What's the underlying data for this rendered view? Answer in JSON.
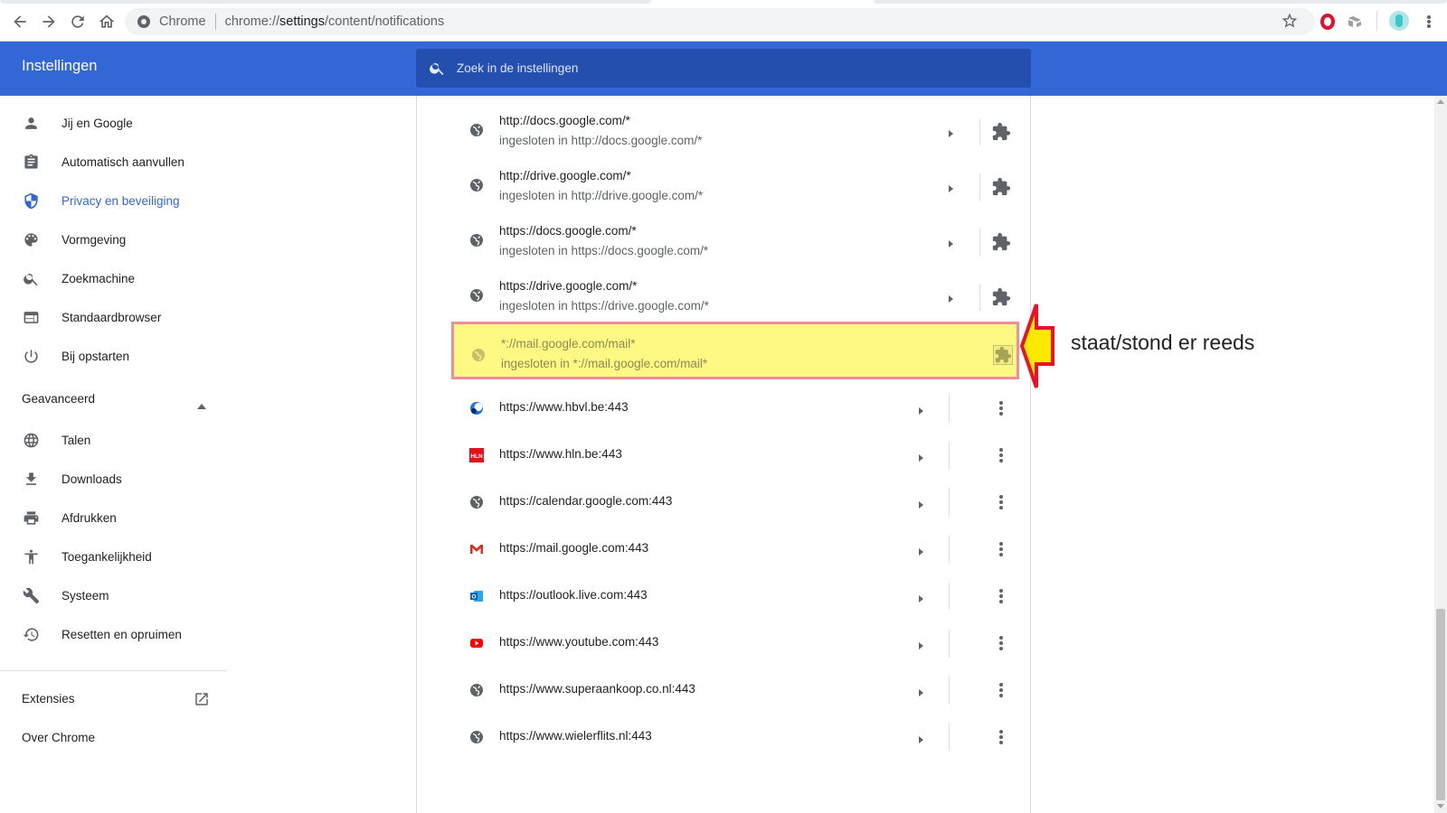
{
  "browser": {
    "chip_label": "Chrome",
    "url_scheme": "chrome://",
    "url_host": "settings",
    "url_path": "/content/notifications"
  },
  "header": {
    "title": "Instellingen",
    "search_placeholder": "Zoek in de instellingen"
  },
  "sidebar": {
    "items": [
      {
        "label": "Jij en Google",
        "icon": "person-icon"
      },
      {
        "label": "Automatisch aanvullen",
        "icon": "clipboard-icon"
      },
      {
        "label": "Privacy en beveiliging",
        "icon": "shield-icon",
        "active": true
      },
      {
        "label": "Vormgeving",
        "icon": "palette-icon"
      },
      {
        "label": "Zoekmachine",
        "icon": "search-icon"
      },
      {
        "label": "Standaardbrowser",
        "icon": "browser-window-icon"
      },
      {
        "label": "Bij opstarten",
        "icon": "power-icon"
      }
    ],
    "advanced_heading": "Geavanceerd",
    "advanced_items": [
      {
        "label": "Talen",
        "icon": "globe-icon"
      },
      {
        "label": "Downloads",
        "icon": "download-icon"
      },
      {
        "label": "Afdrukken",
        "icon": "printer-icon"
      },
      {
        "label": "Toegankelijkheid",
        "icon": "accessibility-icon"
      },
      {
        "label": "Systeem",
        "icon": "wrench-icon"
      },
      {
        "label": "Resetten en opruimen",
        "icon": "restore-icon"
      }
    ],
    "extensions_label": "Extensies",
    "about_label": "Over Chrome"
  },
  "embedded_sites": [
    {
      "url": "http://docs.google.com/*",
      "sub": "ingesloten in http://docs.google.com/*"
    },
    {
      "url": "http://drive.google.com/*",
      "sub": "ingesloten in http://drive.google.com/*"
    },
    {
      "url": "https://docs.google.com/*",
      "sub": "ingesloten in https://docs.google.com/*"
    },
    {
      "url": "https://drive.google.com/*",
      "sub": "ingesloten in https://drive.google.com/*"
    }
  ],
  "highlighted_site": {
    "url": "*://mail.google.com/mail*",
    "sub": "ingesloten in *://mail.google.com/mail*"
  },
  "sites": [
    {
      "url": "https://www.hbvl.be:443",
      "icon": "hbvl-icon"
    },
    {
      "url": "https://www.hln.be:443",
      "icon": "hln-icon"
    },
    {
      "url": "https://calendar.google.com:443",
      "icon": "globe-icon"
    },
    {
      "url": "https://mail.google.com:443",
      "icon": "gmail-icon"
    },
    {
      "url": "https://outlook.live.com:443",
      "icon": "outlook-icon"
    },
    {
      "url": "https://www.youtube.com:443",
      "icon": "youtube-icon"
    },
    {
      "url": "https://www.superaankoop.co.nl:443",
      "icon": "globe-icon"
    },
    {
      "url": "https://www.wielerflits.nl:443",
      "icon": "globe-icon"
    }
  ],
  "annotation": {
    "text": "staat/stond er reeds"
  },
  "colors": {
    "header_blue": "#3367d6",
    "highlight_yellow": "#fff983",
    "arrow_red": "#e8122a"
  }
}
